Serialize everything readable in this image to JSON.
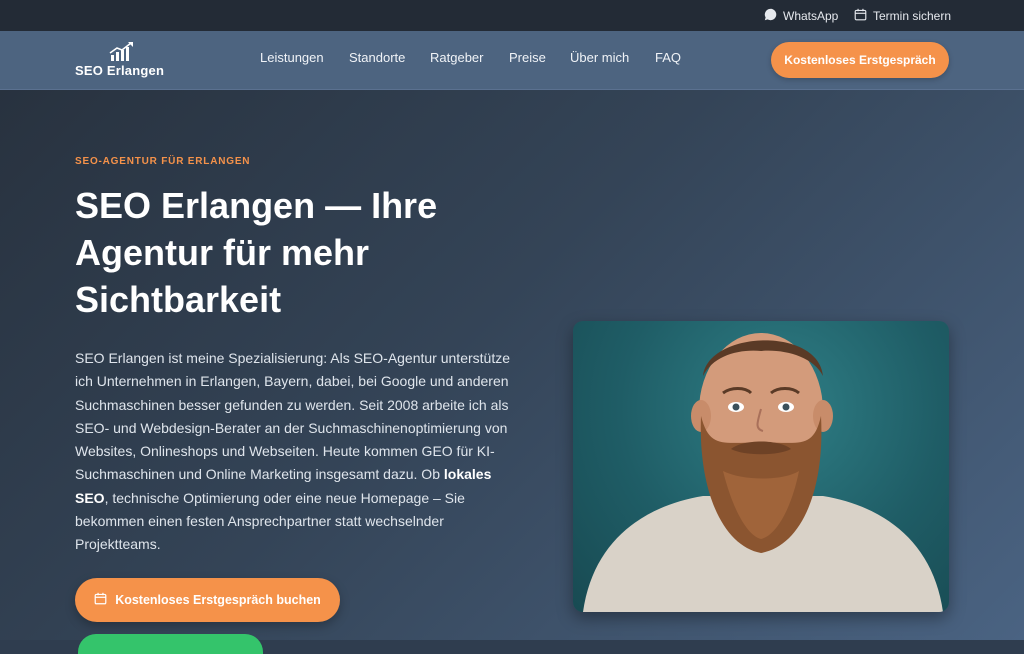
{
  "topbar": {
    "whatsapp": "WhatsApp",
    "termin": "Termin sichern"
  },
  "brand": {
    "name": "SEO Erlangen"
  },
  "nav": {
    "items": [
      "Leistungen",
      "Standorte",
      "Ratgeber",
      "Preise",
      "Über mich",
      "FAQ"
    ],
    "cta": "Kostenloses Erstgespräch"
  },
  "hero": {
    "eyebrow": "SEO-AGENTUR FÜR ERLANGEN",
    "title": "SEO Erlangen — Ihre Agentur für mehr Sichtbarkeit",
    "desc_before": "SEO Erlangen ist meine Spezialisierung: Als SEO-Agentur unterstütze ich Unternehmen in Erlangen, Bayern, dabei, bei Google und anderen Suchmaschinen besser gefunden zu werden. Seit 2008 arbeite ich als SEO- und Webdesign-Berater an der Suchmaschinenoptimierung von Websites, Onlineshops und Webseiten. Heute kommen GEO für KI-Suchmaschinen und Online Marketing insgesamt dazu. Ob ",
    "desc_bold": "lokales SEO",
    "desc_after": ", technische Optimierung oder eine neue Homepage – Sie bekommen einen festen Ansprechpartner statt wechselnder Projektteams.",
    "cta": "Kostenloses Erstgespräch buchen"
  },
  "colors": {
    "accent": "#f5924a",
    "nav_bg": "#4d6480",
    "topbar_bg": "#232b36",
    "green": "#34c46b"
  },
  "icons": [
    "whatsapp-icon",
    "calendar-icon",
    "chart-logo-icon"
  ]
}
